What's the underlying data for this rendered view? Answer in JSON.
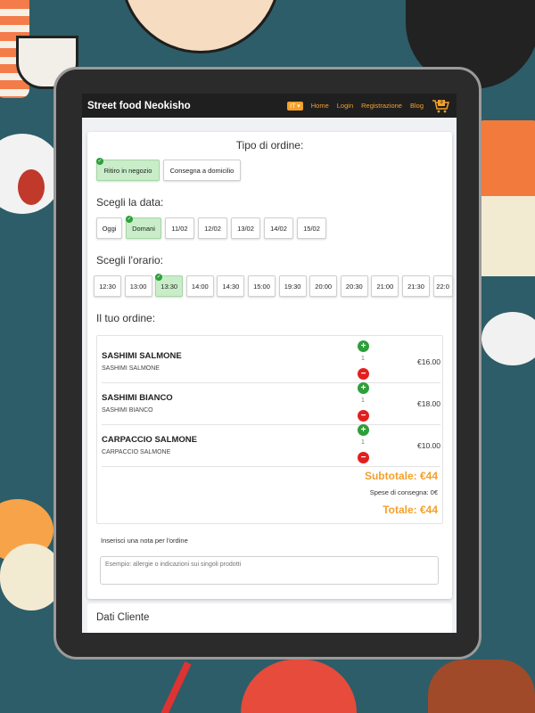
{
  "navbar": {
    "brand": "Street food Neokisho",
    "lang": "IT",
    "links": [
      "Home",
      "Login",
      "Registrazione",
      "Blog"
    ],
    "cart_count": "3"
  },
  "order_type": {
    "title": "Tipo di ordine:",
    "options": [
      {
        "label": "Ritiro in negozio",
        "selected": true
      },
      {
        "label": "Consegna a domicilio",
        "selected": false
      }
    ]
  },
  "date": {
    "title": "Scegli la data:",
    "options": [
      {
        "label": "Oggi",
        "selected": false
      },
      {
        "label": "Domani",
        "selected": true
      },
      {
        "label": "11/02",
        "selected": false
      },
      {
        "label": "12/02",
        "selected": false
      },
      {
        "label": "13/02",
        "selected": false
      },
      {
        "label": "14/02",
        "selected": false
      },
      {
        "label": "15/02",
        "selected": false
      }
    ]
  },
  "time": {
    "title": "Scegli l'orario:",
    "options": [
      {
        "label": "12:30",
        "selected": false
      },
      {
        "label": "13:00",
        "selected": false
      },
      {
        "label": "13:30",
        "selected": true
      },
      {
        "label": "14:00",
        "selected": false
      },
      {
        "label": "14:30",
        "selected": false
      },
      {
        "label": "15:00",
        "selected": false
      },
      {
        "label": "19:30",
        "selected": false
      },
      {
        "label": "20:00",
        "selected": false
      },
      {
        "label": "20:30",
        "selected": false
      },
      {
        "label": "21:00",
        "selected": false
      },
      {
        "label": "21:30",
        "selected": false
      },
      {
        "label": "22:0",
        "selected": false
      }
    ]
  },
  "order": {
    "title": "Il tuo ordine:",
    "items": [
      {
        "name": "SASHIMI SALMONE",
        "sub": "SASHIMI SALMONE",
        "qty": "1",
        "price": "€16.00"
      },
      {
        "name": "SASHIMI BIANCO",
        "sub": "SASHIMI BIANCO",
        "qty": "1",
        "price": "€18.00"
      },
      {
        "name": "CARPACCIO SALMONE",
        "sub": "CARPACCIO SALMONE",
        "qty": "1",
        "price": "€10.00"
      }
    ],
    "subtotal": "Subtotale: €44",
    "shipping": "Spese di consegna: 0€",
    "total": "Totale: €44"
  },
  "note": {
    "label": "Inserisci una nota per l'ordine",
    "placeholder": "Esempio: allergie o indicazioni sui singoli prodotti"
  },
  "customer": {
    "title": "Dati Cliente"
  }
}
